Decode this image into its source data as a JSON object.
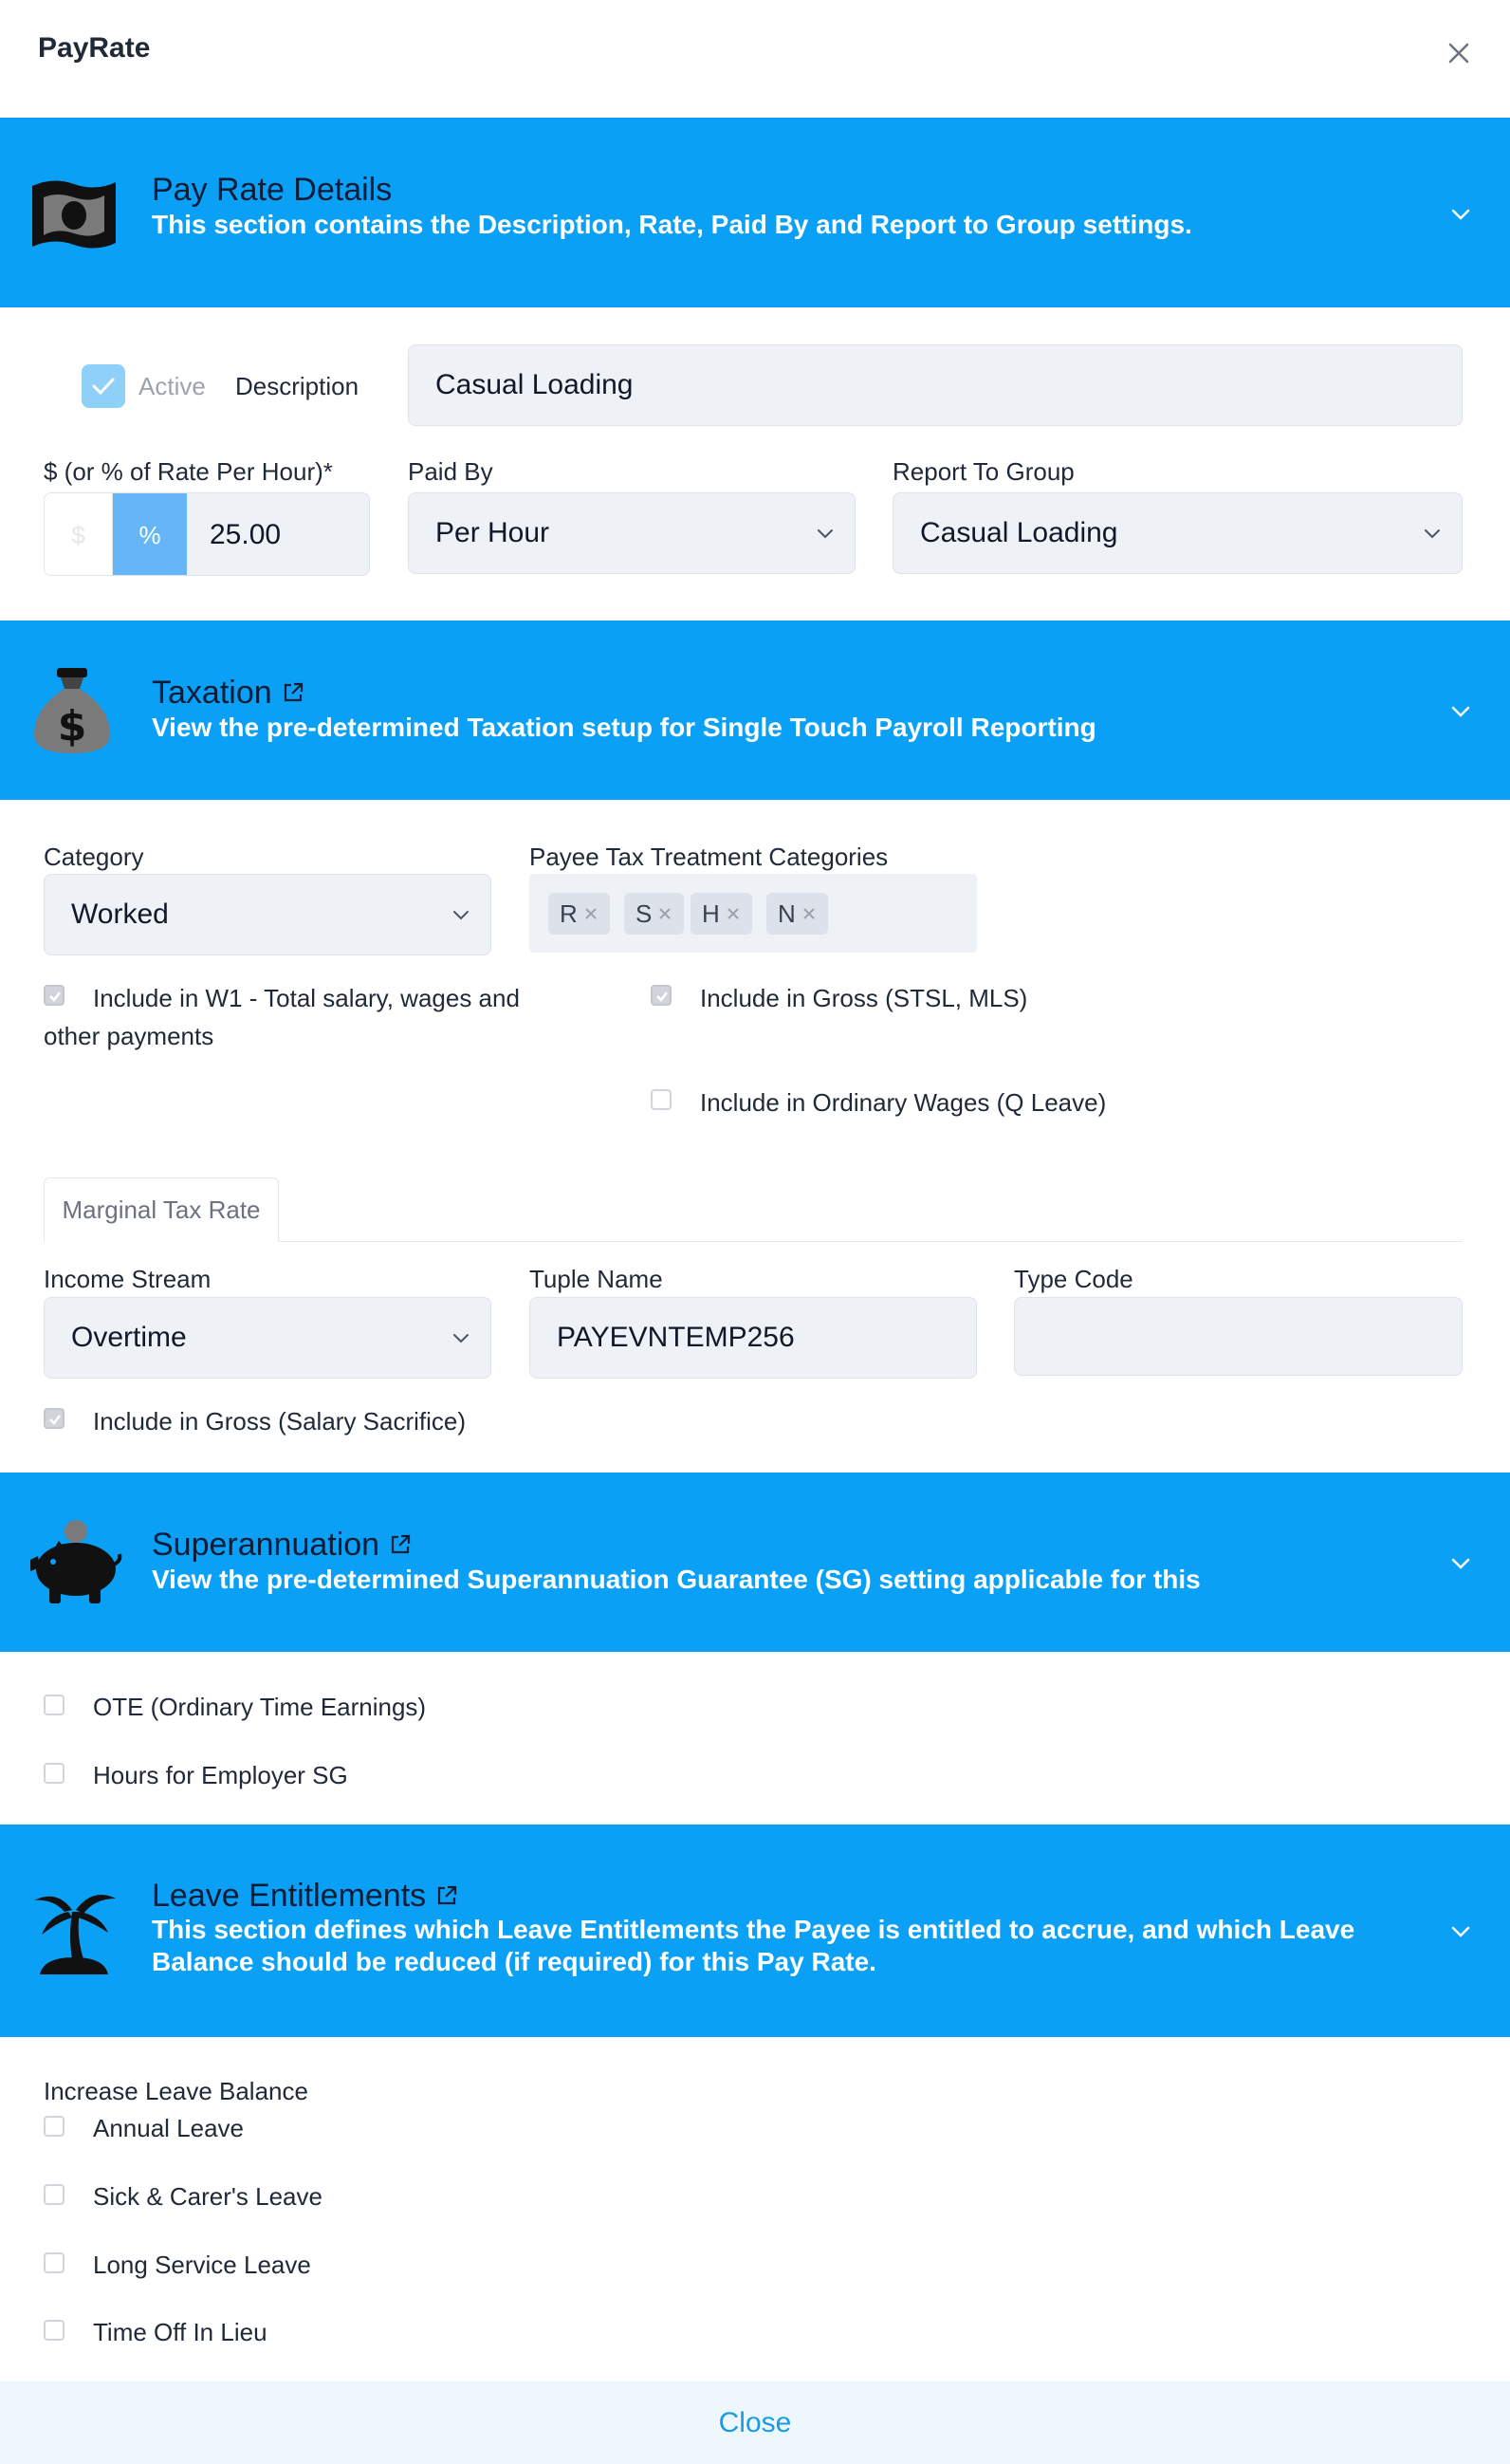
{
  "header": {
    "title": "PayRate"
  },
  "sections": {
    "pay_rate": {
      "title": "Pay Rate Details",
      "subtitle": "This section contains the Description, Rate, Paid By and Report to Group settings."
    },
    "taxation": {
      "title": "Taxation",
      "subtitle": "View the pre-determined Taxation setup for Single Touch Payroll Reporting"
    },
    "super": {
      "title": "Superannuation",
      "subtitle": "View the pre-determined Superannuation Guarantee (SG) setting applicable for this"
    },
    "leave": {
      "title": "Leave Entitlements",
      "subtitle": "This section defines which Leave Entitlements the Payee is entitled to accrue, and which Leave Balance should be reduced (if required) for this Pay Rate."
    }
  },
  "pay_rate": {
    "active_label": "Active",
    "description_label": "Description",
    "description_value": "Casual Loading",
    "rate_label": "$ (or % of Rate Per Hour)*",
    "dollar_symbol": "$",
    "percent_symbol": "%",
    "rate_value": "25.00",
    "paid_by_label": "Paid By",
    "paid_by_value": "Per Hour",
    "report_group_label": "Report To Group",
    "report_group_value": "Casual Loading"
  },
  "taxation": {
    "category_label": "Category",
    "category_value": "Worked",
    "treatment_label": "Payee Tax Treatment Categories",
    "chips": [
      "R",
      "S",
      "H",
      "N"
    ],
    "w1_label_line1": "Include in W1 - Total salary, wages and",
    "w1_label_line2": "other payments",
    "gross_stsl_label": "Include in Gross (STSL, MLS)",
    "ordinary_wages_label": "Include in Ordinary Wages (Q Leave)",
    "tab_label": "Marginal Tax Rate",
    "income_stream_label": "Income Stream",
    "income_stream_value": "Overtime",
    "tuple_name_label": "Tuple Name",
    "tuple_name_value": "PAYEVNTEMP256",
    "type_code_label": "Type Code",
    "type_code_value": "",
    "salary_sacrifice_label": "Include in Gross (Salary Sacrifice)"
  },
  "super": {
    "ote_label": "OTE (Ordinary Time Earnings)",
    "hours_sg_label": "Hours for Employer SG"
  },
  "leave": {
    "increase_label": "Increase Leave Balance",
    "items": [
      "Annual Leave",
      "Sick & Carer's Leave",
      "Long Service Leave",
      "Time Off In Lieu"
    ]
  },
  "footer": {
    "close_label": "Close"
  },
  "colors": {
    "banner": "#0aa0f5",
    "accent": "#1a9be6"
  }
}
